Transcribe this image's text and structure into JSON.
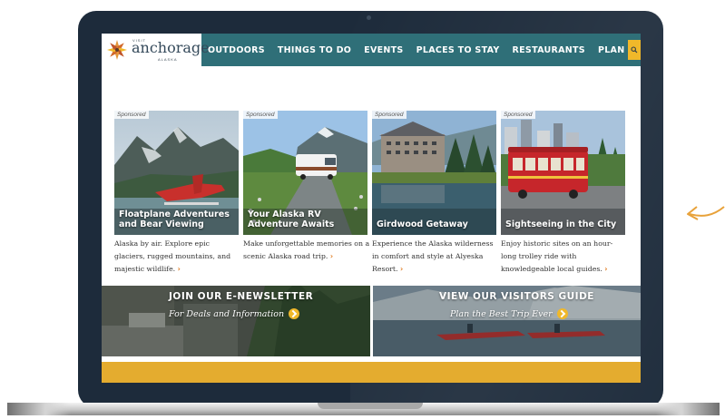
{
  "brand": {
    "visit": "VISIT",
    "name": "anchorage",
    "region": "ALASKA"
  },
  "nav": {
    "items": [
      "OUTDOORS",
      "THINGS TO DO",
      "EVENTS",
      "PLACES TO STAY",
      "RESTAURANTS",
      "PLAN YOUR TRIP"
    ]
  },
  "cards": [
    {
      "badge": "Sponsored",
      "title": "Floatplane Adventures and Bear Viewing",
      "desc": "Alaska by air. Explore epic glaciers, rugged mountains, and majestic wildlife.",
      "chevron": "›"
    },
    {
      "badge": "Sponsored",
      "title": "Your Alaska RV Adventure Awaits",
      "desc": "Make unforgettable memories on a scenic Alaska road trip.",
      "chevron": "›"
    },
    {
      "badge": "Sponsored",
      "title": "Girdwood Getaway",
      "desc": "Experience the Alaska wilderness in comfort and style at Alyeska Resort.",
      "chevron": "›"
    },
    {
      "badge": "Sponsored",
      "title": "Sightseeing in the City",
      "desc": "Enjoy historic sites on an hour-long trolley ride with knowledgeable local guides.",
      "chevron": "›"
    }
  ],
  "banners": {
    "newsletter": {
      "title": "JOIN OUR E-NEWSLETTER",
      "subtitle": "For Deals and Information"
    },
    "guide": {
      "title": "VIEW OUR VISITORS GUIDE",
      "subtitle": "Plan the Best Trip Ever"
    }
  },
  "colors": {
    "nav_bg": "#2f6f78",
    "accent_gold": "#e4ac2f",
    "chevron": "#e07a1e",
    "laptop_bezel": "#1d2b3b"
  },
  "icons": [
    "search-icon",
    "arrow-circle-icon",
    "side-arrow-icon",
    "logo-star-icon"
  ]
}
